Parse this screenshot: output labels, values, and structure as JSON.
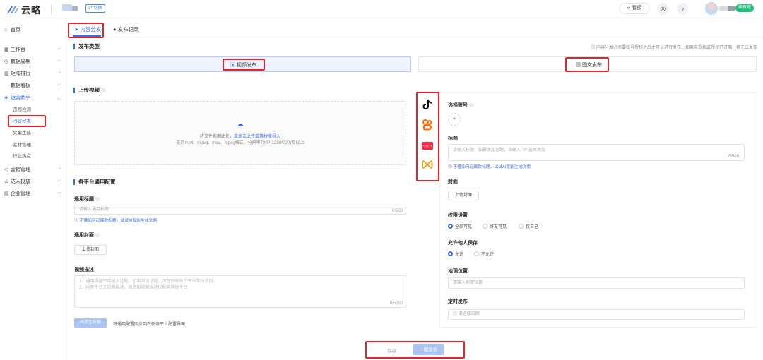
{
  "app": {
    "logo_text": "云略",
    "switch_label": "切换"
  },
  "header": {
    "help_label": "看板",
    "vip_label": "续有效"
  },
  "sidebar": {
    "items": [
      {
        "label": "首页",
        "icon": "home-icon"
      },
      {
        "label": "工作台",
        "icon": "grid-icon"
      },
      {
        "label": "数据周期",
        "icon": "clock-icon"
      },
      {
        "label": "矩阵排行",
        "icon": "bar-chart-icon"
      },
      {
        "label": "数据看板",
        "icon": "dashboard-icon"
      },
      {
        "label": "运营助手",
        "icon": "assistant-icon"
      }
    ],
    "sub_items": [
      "违规检测",
      "内容分发",
      "文案生成",
      "素材管理",
      "行业热点"
    ],
    "items_after": [
      {
        "label": "营销管理",
        "icon": "megaphone-icon"
      },
      {
        "label": "达人投放",
        "icon": "person-icon"
      },
      {
        "label": "企业管理",
        "icon": "building-icon"
      }
    ]
  },
  "tabs": {
    "distribute": "内容分发",
    "records": "发布记录"
  },
  "publish_type": {
    "title": "发布类型",
    "notice": "内容分发必须要账号授权之后才可以进行发布，如果未授权或授权已过期，将无法发布",
    "video": "视频发布",
    "image": "图文发布"
  },
  "upload": {
    "title": "上传视频",
    "hint_prefix": "将文件拖到此处，",
    "hint_link": "或点击上传或素材库导入",
    "formats": "支持mp4、mpeg、mov、mpeg格式，分辨率720P(1280*720)及以上"
  },
  "common": {
    "title": "各平台通用配置",
    "title_label": "通用标题",
    "title_placeholder": "请输入通用标题",
    "title_counter": "0/500",
    "ai_link": "① 不懂如何起爆款标题，试试AI智能生成文案",
    "cover_label": "通用封面",
    "cover_button": "上传封面",
    "desc_label": "视频描述",
    "desc_placeholder_1": "1、通用内容不可输入话题，如果添加话题，请在右侧每个平台单独添加；",
    "desc_placeholder_2": "2、抖音平台无视频描述，如添加视频描述仅影响其他平台",
    "desc_counter": "0/5000",
    "sync_button": "同步至右侧",
    "sync_hint": "将通用配置同步到右侧各平台配置界面"
  },
  "platforms": [
    {
      "name": "抖音",
      "icon": "douyin-icon"
    },
    {
      "name": "快手",
      "icon": "kuaishou-icon"
    },
    {
      "name": "小红书",
      "icon": "xiaohongshu-icon",
      "badge": "小红书"
    },
    {
      "name": "视频号",
      "icon": "channels-icon"
    }
  ],
  "right_form": {
    "account_label": "选择账号",
    "add_symbol": "+",
    "title_label": "标题",
    "title_placeholder": "请输入标题，如需添加话题，请输入 \"#\" 选择添加",
    "title_counter": "0/500",
    "ai_link": "① 不懂如何起爆款标题，试试AI智能生成文案",
    "cover_label": "封面",
    "cover_button": "上传封面",
    "perm_label": "权限设置",
    "perm_options": [
      "全部可见",
      "好友可见",
      "仅自己"
    ],
    "save_label": "允许他人保存",
    "save_options": [
      "允许",
      "不允许"
    ],
    "location_label": "地理位置",
    "location_placeholder": "请输入地理位置",
    "schedule_label": "定时发布",
    "schedule_placeholder": "① 请选择日期"
  },
  "footer": {
    "save": "保存",
    "publish": "一键发布"
  },
  "colors": {
    "accent": "#3a6ee8",
    "highlight": "#e0262b",
    "vip": "#21c07a"
  }
}
